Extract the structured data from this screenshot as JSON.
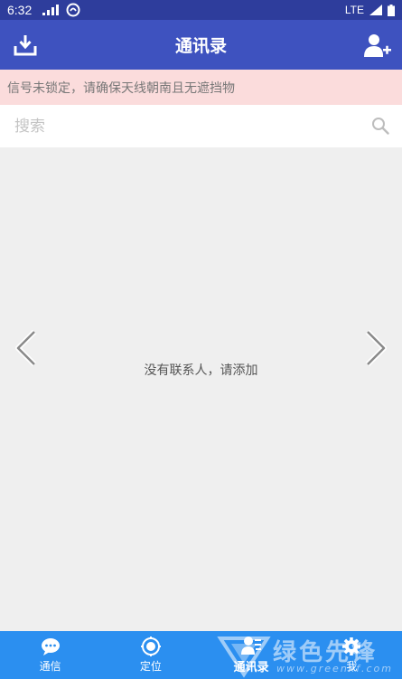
{
  "status_bar": {
    "time": "6:32",
    "network": "LTE"
  },
  "app_bar": {
    "title": "通讯录"
  },
  "warning": {
    "text": "信号未锁定，请确保天线朝南且无遮挡物"
  },
  "search": {
    "placeholder": "搜索"
  },
  "content": {
    "empty_text": "没有联系人，请添加"
  },
  "tabs": [
    {
      "label": "通信",
      "icon": "chat-icon"
    },
    {
      "label": "定位",
      "icon": "location-icon"
    },
    {
      "label": "通讯录",
      "icon": "contacts-icon",
      "active": true
    },
    {
      "label": "我",
      "icon": "gear-icon"
    }
  ],
  "watermark": {
    "text": "绿色先锋",
    "url": "www.greenxf.com"
  },
  "colors": {
    "status_bar": "#2e3d9c",
    "app_bar": "#3e52bf",
    "warning_bg": "#fbdcdc",
    "tab_bar": "#2b8ff0",
    "content_bg": "#efefef"
  }
}
